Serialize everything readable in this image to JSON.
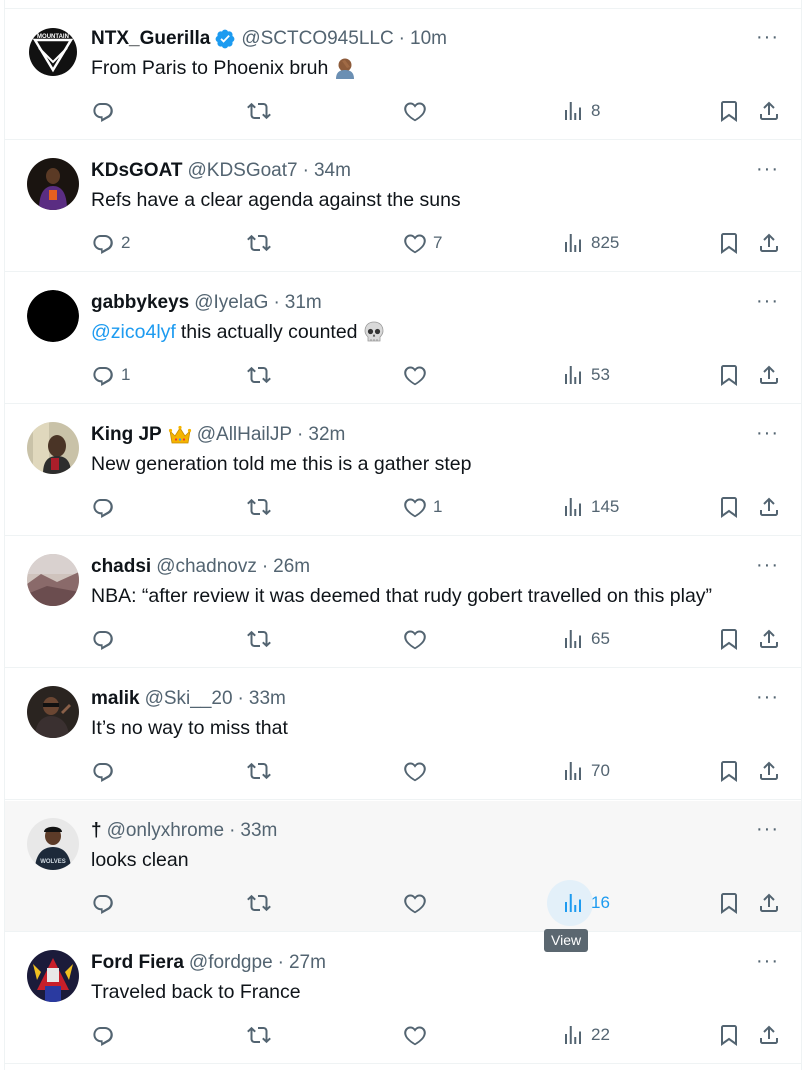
{
  "tweets": [
    {
      "name": "NTX_Guerilla",
      "handle": "@SCTCO945LLC",
      "time": "10m",
      "text": "From Paris to Phoenix bruh",
      "reply": "",
      "retweet": "",
      "like": "",
      "views": "8",
      "avatar_text": "MOUNTAIN"
    },
    {
      "name": "KDsGOAT",
      "handle": "@KDSGoat7",
      "time": "34m",
      "text": "Refs have a clear agenda against the suns",
      "reply": "2",
      "retweet": "",
      "like": "7",
      "views": "825"
    },
    {
      "name": "gabbykeys",
      "handle": "@IyelaG",
      "time": "31m",
      "mention": "@zico4lyf",
      "text": "this actually counted",
      "reply": "1",
      "retweet": "",
      "like": "",
      "views": "53"
    },
    {
      "name": "King JP",
      "handle": "@AllHailJP",
      "time": "32m",
      "text": "New generation told me this is a gather step",
      "reply": "",
      "retweet": "",
      "like": "1",
      "views": "145"
    },
    {
      "name": "chadsi",
      "handle": "@chadnovz",
      "time": "26m",
      "text": "NBA: “after review it was deemed that rudy gobert travelled on this play”",
      "reply": "",
      "retweet": "",
      "like": "",
      "views": "65"
    },
    {
      "name": "malik",
      "handle": "@Ski__20",
      "time": "33m",
      "text": "It’s no way to miss that",
      "reply": "",
      "retweet": "",
      "like": "",
      "views": "70"
    },
    {
      "name": "†",
      "handle": "@onlyxhrome",
      "time": "33m",
      "text": "looks clean",
      "reply": "",
      "retweet": "",
      "like": "",
      "views": "16",
      "avatar_text": "WOLVES"
    },
    {
      "name": "Ford Fiera",
      "handle": "@fordgpe",
      "time": "27m",
      "text": "Traveled back to France",
      "reply": "",
      "retweet": "",
      "like": "",
      "views": "22"
    }
  ],
  "more_label": "···",
  "tooltip": "View",
  "colors": {
    "accent": "#1d9bf0",
    "muted": "#536471",
    "text": "#0f1419",
    "hover_bg": "#f7f7f7"
  },
  "icons": [
    "verified-badge-icon",
    "reply-icon",
    "retweet-icon",
    "like-icon",
    "views-icon",
    "bookmark-icon",
    "share-icon",
    "more-icon",
    "skull-emoji-icon",
    "crown-emoji-icon",
    "facepalm-emoji-icon"
  ]
}
